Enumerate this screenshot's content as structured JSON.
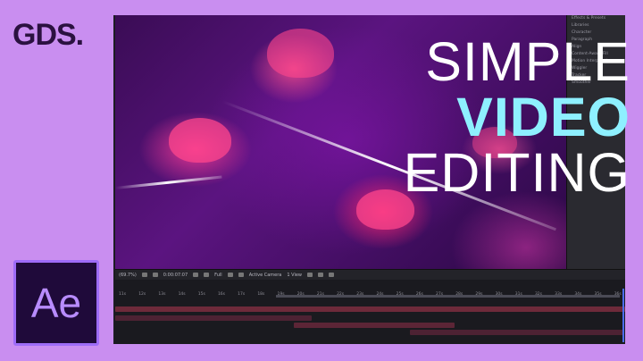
{
  "brand": {
    "logo_text": "GDS."
  },
  "headline": {
    "line1": "SIMPLE",
    "line2": "VIDEO",
    "line3": "EDITING"
  },
  "badge": {
    "text": "Ae"
  },
  "panel": {
    "items": [
      "Effects & Presets",
      "Libraries",
      "Character",
      "Paragraph",
      "Align",
      "Content-Aware Fill",
      "Motion Interpolation",
      "Wiggler",
      "Tracker",
      "Smoother"
    ]
  },
  "toolbar": {
    "zoom": "(69.7%)",
    "timecode": "0:00:07:07",
    "resolution": "Full",
    "camera": "Active Camera",
    "views": "1 View"
  },
  "timeline": {
    "ticks": [
      "11s",
      "12s",
      "13s",
      "14s",
      "15s",
      "16s",
      "17s",
      "18s",
      "19s",
      "20s",
      "21s",
      "22s",
      "23s",
      "24s",
      "25s",
      "26s",
      "27s",
      "28s",
      "29s",
      "30s",
      "31s",
      "32s",
      "33s",
      "34s",
      "35s",
      "36s"
    ]
  }
}
